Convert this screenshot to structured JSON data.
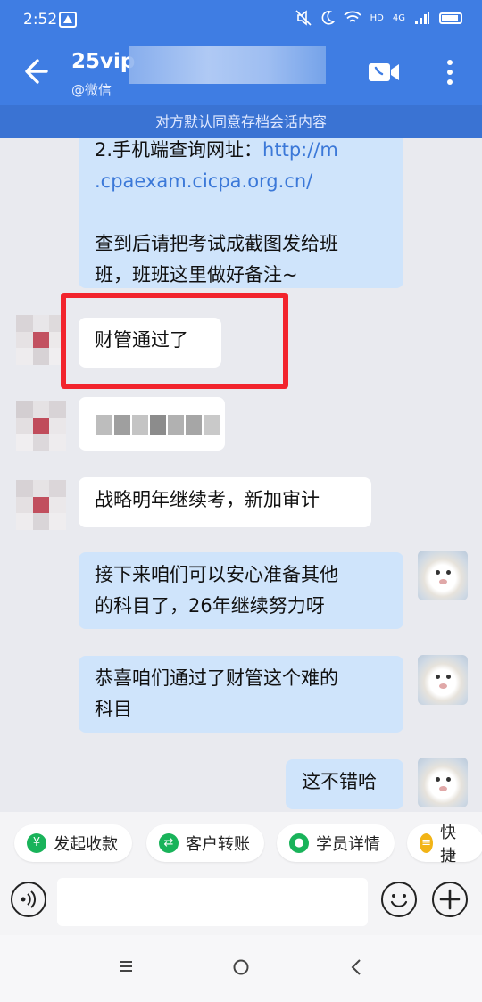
{
  "status_bar": {
    "time": "2:52",
    "network": "4G",
    "hd": "HD"
  },
  "header": {
    "title": "25vip",
    "subtitle": "@微信",
    "archive_notice": "对方默认同意存档会话内容"
  },
  "messages": [
    {
      "side": "out",
      "text_line1": "2.手机端查询网址：",
      "link": "http://m.cpaexam.cicpa.org.cn/",
      "link_line1": "http://m",
      "link_line2": ".cpaexam.cicpa.org.cn/",
      "text2": "查到后请把考试成截图发给班班，班班这里做好备注~",
      "text2_line1": "查到后请把考试成截图发给班",
      "text2_line2": "班，班班这里做好备注~"
    },
    {
      "side": "in",
      "text": "财管通过了"
    },
    {
      "side": "in",
      "text": ""
    },
    {
      "side": "in",
      "text": "战略明年继续考，新加审计"
    },
    {
      "side": "out",
      "line1": "接下来咱们可以安心准备其他",
      "line2": "的科目了，26年继续努力呀"
    },
    {
      "side": "out",
      "line1": "恭喜咱们通过了财管这个难的",
      "line2": "科目"
    },
    {
      "side": "out",
      "text": "这不错哈"
    }
  ],
  "quick_actions": [
    {
      "label": "发起收款",
      "icon": "yen-icon",
      "color": "#19b35a"
    },
    {
      "label": "客户转账",
      "icon": "transfer-icon",
      "color": "#19b35a"
    },
    {
      "label": "学员详情",
      "icon": "user-icon",
      "color": "#19b35a"
    },
    {
      "label": "快捷",
      "icon": "quick-reply-icon",
      "color": "#f2b416"
    }
  ],
  "input": {
    "placeholder": ""
  },
  "colors": {
    "header": "#3f7de3",
    "bubble_out": "#cfe4fb",
    "highlight": "#f2242d",
    "link": "#3b78d8"
  }
}
